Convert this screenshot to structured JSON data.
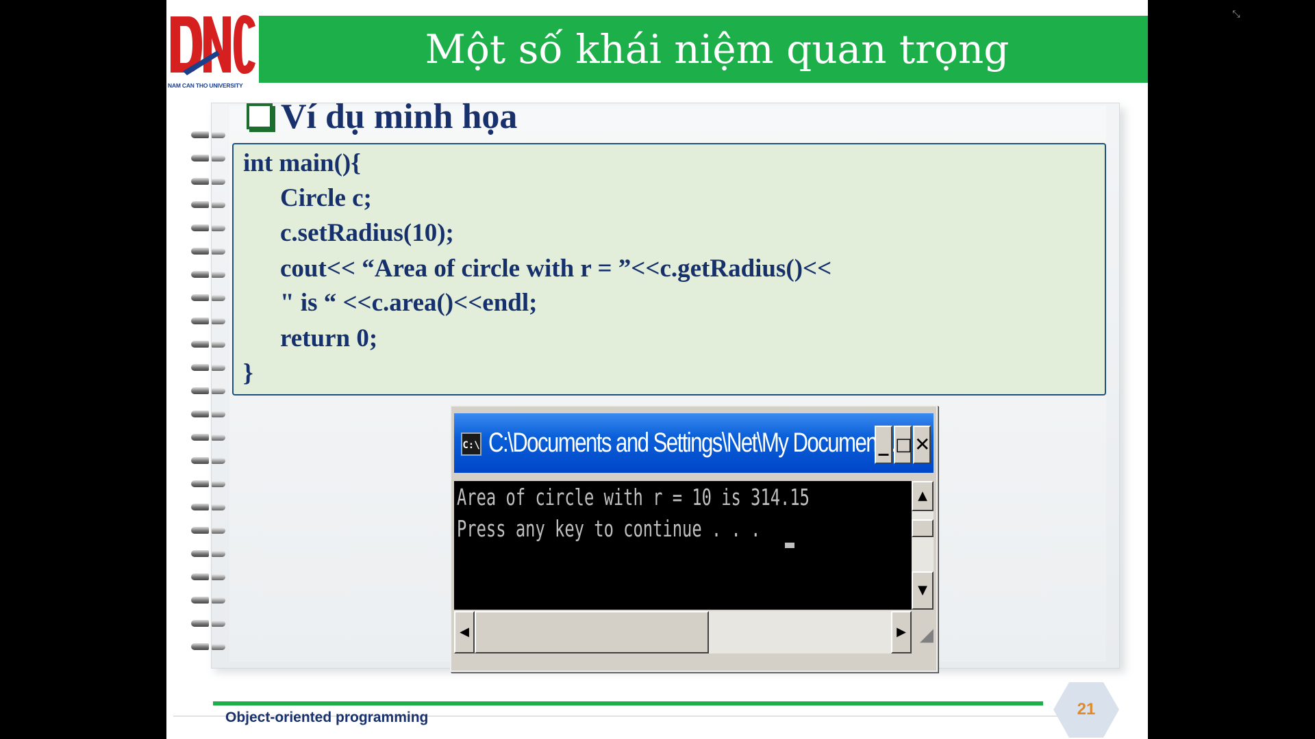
{
  "viewer": {
    "exit_fullscreen_icon": "⤡"
  },
  "slide": {
    "title": "Một số khái niệm quan trọng",
    "logo": {
      "letters": "DNC",
      "subtitle": "NAM CAN THO UNIVERSITY"
    },
    "section_heading": "Ví dụ minh họa",
    "code_lines": [
      "int main(){",
      "Circle c;",
      "c.setRadius(10);",
      "cout<< “Area of circle with r = ”<<c.getRadius()<<",
      "\" is “ <<c.area()<<endl;",
      "return 0;",
      "}"
    ],
    "console": {
      "title": "C:\\Documents and Settings\\Net\\My Documents...",
      "icon_text": "C:\\",
      "output_lines": [
        "Area of circle with r = 10 is 314.15",
        "Press any key to continue . . ."
      ]
    },
    "footer": {
      "course": "Object-oriented programming",
      "page_number": "21"
    }
  },
  "colors": {
    "title_bar": "#1db04a",
    "heading_text": "#18306b",
    "code_bg": "#e2eed9",
    "logo_red": "#d6201f",
    "page_number": "#e08a2e",
    "console_titlebar": "#0a5fd8"
  }
}
